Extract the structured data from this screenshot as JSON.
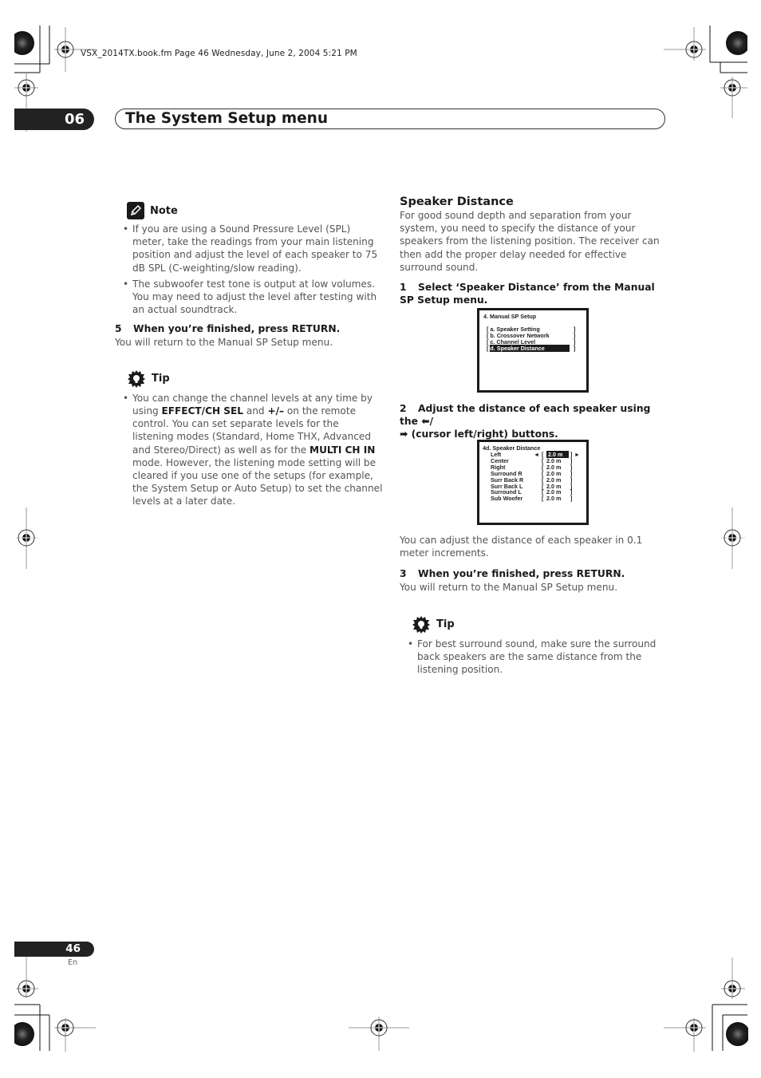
{
  "header": {
    "file_info": "VSX_2014TX.book.fm  Page 46  Wednesday, June 2, 2004  5:21 PM",
    "chapter_number": "06",
    "chapter_title": "The System Setup menu"
  },
  "left_column": {
    "note": {
      "icon": "pencil-icon",
      "title": "Note",
      "bullets": [
        "If you are using a Sound Pressure Level (SPL) meter, take the readings from your main listening position and adjust the level of each speaker to 75 dB SPL (C-weighting/slow reading).",
        "The subwoofer test tone is output at low volumes. You may need to adjust the level after testing with an actual soundtrack."
      ]
    },
    "step5": {
      "number": "5",
      "text": "When you’re finished, press RETURN.",
      "body": "You will return to the Manual SP Setup menu."
    },
    "tip": {
      "icon": "lightbulb-icon",
      "title": "Tip",
      "bullet_parts": {
        "p1": "You can change the channel levels at any time by using ",
        "b1": "EFFECT/CH SEL",
        "p2": " and ",
        "b2": "+/–",
        "p3": " on the remote control. You can set separate levels for the listening modes (Standard, Home THX, Advanced and Stereo/Direct) as well as for the ",
        "b3": "MULTI CH IN",
        "p4": " mode. However, the listening mode setting will be cleared if you use one of the setups (for example, the System Setup or Auto Setup) to set the channel levels at a later date."
      }
    }
  },
  "right_column": {
    "heading": "Speaker Distance",
    "intro": "For good sound depth and separation from your system, you need to specify the distance of your speakers from the listening position. The receiver can then add the proper delay needed for effective surround sound.",
    "step1": {
      "number": "1",
      "text": "Select ‘Speaker Distance’ from the Manual SP Setup menu."
    },
    "screen1": {
      "title": "4. Manual SP Setup",
      "items": [
        "a. Speaker Setting",
        "b. Crossover Network",
        "c. Channel Level",
        "d. Speaker Distance"
      ],
      "selected_index": 3
    },
    "step2": {
      "number": "2",
      "text_a": "Adjust the distance of each speaker using the ",
      "left_arrow": "⬅",
      "slash": "/",
      "right_arrow": "➡",
      "text_b": " (cursor left/right) buttons."
    },
    "screen2": {
      "title": "4d. Speaker Distance",
      "left_marker": "◄",
      "right_marker": "►",
      "rows": [
        {
          "label": "Left",
          "value": "2.0 m",
          "selected": true
        },
        {
          "label": "Center",
          "value": "2.0 m"
        },
        {
          "label": "Right",
          "value": "2.0 m"
        },
        {
          "label": "Surround R",
          "value": "2.0 m"
        },
        {
          "label": "Surr Back R",
          "value": "2.0 m"
        },
        {
          "label": "Surr Back L",
          "value": "2.0 m"
        },
        {
          "label": "Surround L",
          "value": "2.0 m"
        },
        {
          "label": "Sub Woofer",
          "value": "2.0 m"
        }
      ]
    },
    "increments_note": "You can adjust the distance of each speaker in 0.1 meter increments.",
    "step3": {
      "number": "3",
      "text": "When you’re finished, press RETURN.",
      "body": "You will return to the Manual SP Setup menu."
    },
    "tip": {
      "icon": "lightbulb-icon",
      "title": "Tip",
      "bullets": [
        "For best surround sound, make sure the surround back speakers are the same distance from the listening position."
      ]
    }
  },
  "footer": {
    "page_number": "46",
    "language": "En"
  }
}
